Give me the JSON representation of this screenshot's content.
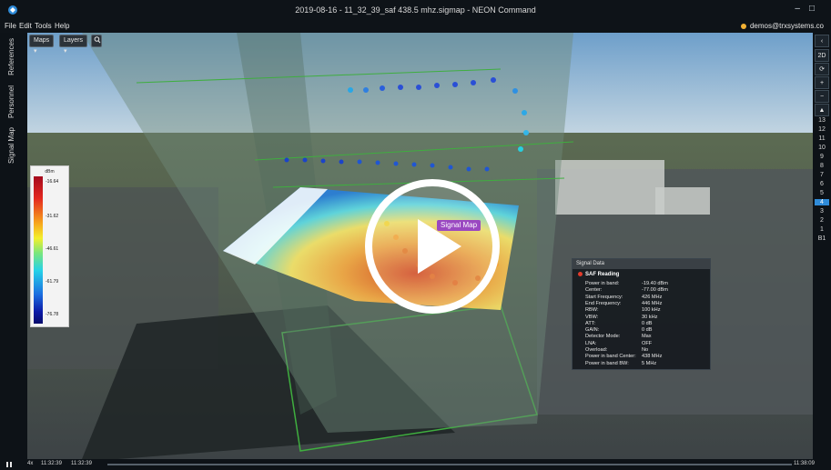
{
  "window": {
    "title": "2019-08-16 - 11_32_39_saf 438.5 mhz.sigmap - NEON Command"
  },
  "menu": [
    "File",
    "Edit",
    "Tools",
    "Help"
  ],
  "user": "demos@trxsystems.co",
  "left_tabs": [
    "References",
    "Personnel",
    "Signal Map"
  ],
  "toolbar": {
    "maps_label": "Maps ▾",
    "layers_label": "Layers ▾",
    "search_icon": "search-icon"
  },
  "rightbar": {
    "view_2d": "2D",
    "floors": [
      "13",
      "12",
      "11",
      "10",
      "9",
      "8",
      "7",
      "6",
      "5",
      "4",
      "3",
      "2",
      "1",
      "B1"
    ],
    "active_floor": "4"
  },
  "legend": {
    "unit": "dBm",
    "ticks": [
      "-16.64",
      "-31.62",
      "-46.61",
      "-61.79",
      "-76.78"
    ]
  },
  "map_tag": "Signal Map",
  "signal_data": {
    "header": "Signal Data",
    "reading_title": "SAF Reading",
    "rows": [
      {
        "k": "Power in band:",
        "v": "-19.40 dBm"
      },
      {
        "k": "Center:",
        "v": "-77.00 dBm"
      },
      {
        "k": "Start Frequency:",
        "v": "426 MHz"
      },
      {
        "k": "End Frequency:",
        "v": "446 MHz"
      },
      {
        "k": "RBW:",
        "v": "100 kHz"
      },
      {
        "k": "VBW:",
        "v": "30 kHz"
      },
      {
        "k": "ATT:",
        "v": "0 dB"
      },
      {
        "k": "GAIN:",
        "v": "0 dB"
      },
      {
        "k": "Detector Mode:",
        "v": "Max"
      },
      {
        "k": "LNA:",
        "v": "OFF"
      },
      {
        "k": "Overload:",
        "v": "No"
      },
      {
        "k": "Power in band Center:",
        "v": "438 MHz"
      },
      {
        "k": "Power in band BW:",
        "v": "5 MHz"
      }
    ]
  },
  "timeline": {
    "speed": "4x",
    "start": "11:32:39",
    "current": "11:32:39",
    "end_left": "11:38:09",
    "end_right": "11:38:0"
  },
  "colors": {
    "sky": "#9fc6e8",
    "accent_blue": "#2f8bd8",
    "map_tag": "#8c2fb9"
  }
}
